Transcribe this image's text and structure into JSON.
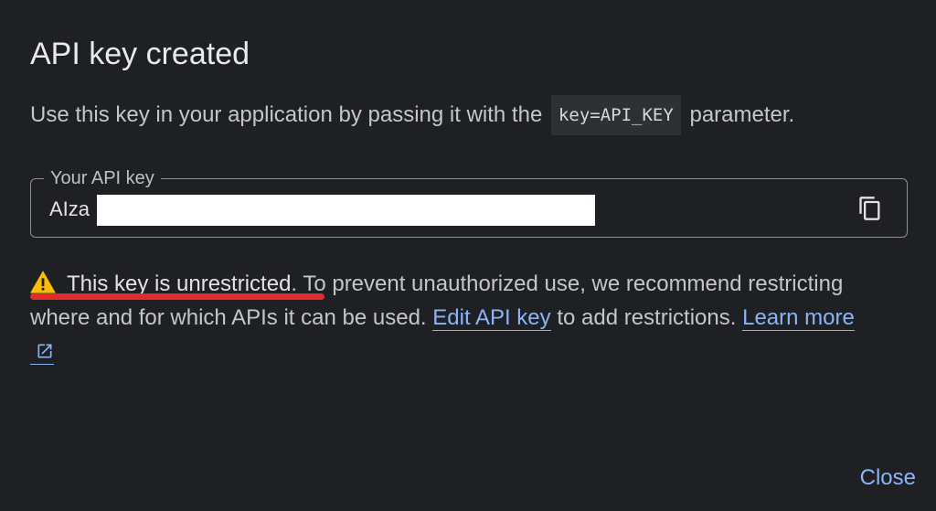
{
  "dialog": {
    "title": "API key created",
    "description": {
      "before_code": "Use this key in your application by passing it with the",
      "code": "key=API_KEY",
      "after_code": "parameter."
    },
    "field": {
      "label": "Your API key",
      "value_prefix": "AIza",
      "copy_icon": "copy-icon"
    },
    "warning": {
      "icon": "warning-triangle-icon",
      "emphasis": "This key is unrestricted",
      "text1": ". To prevent unauthorized use, we recommend restricting where and for which APIs it can be used. ",
      "edit_link": "Edit API key",
      "text2": " to add restrictions. ",
      "learn_link": "Learn more",
      "learn_icon": "external-link-icon"
    },
    "close_label": "Close"
  },
  "colors": {
    "background": "#1f2023",
    "text": "#e3e3e3",
    "link": "#8ab4f8",
    "warning": "#fbbc04",
    "annotation_red": "#e32b2b"
  }
}
